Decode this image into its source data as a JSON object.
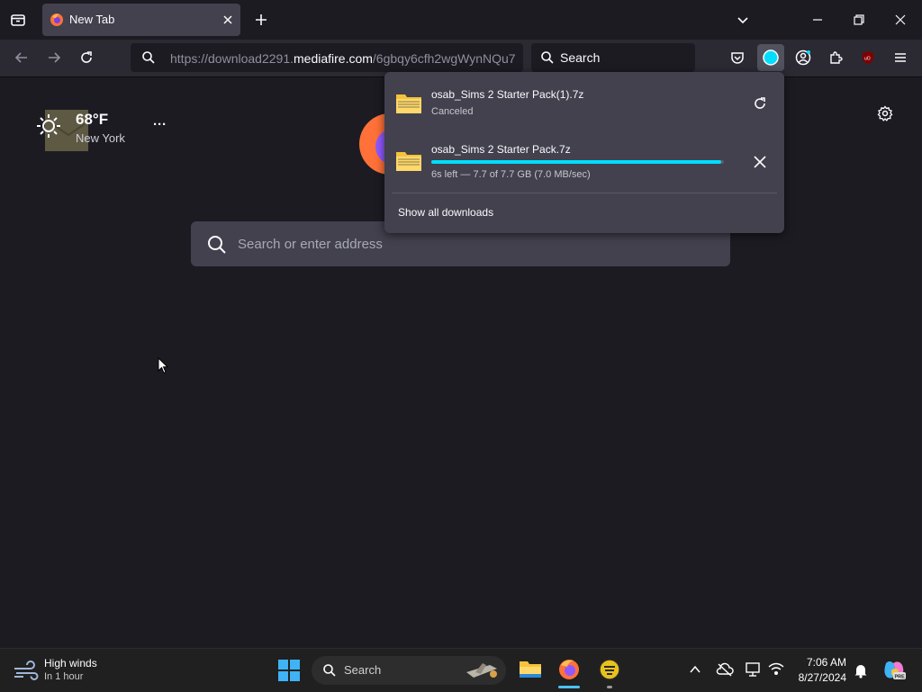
{
  "tab": {
    "title": "New Tab"
  },
  "navbar": {
    "url_prefix": "https://download2291.",
    "url_domain": "mediafire.com",
    "url_suffix": "/6gbqy6cfh2wgWynNQu7",
    "search_placeholder": "Search"
  },
  "weather_widget": {
    "temperature": "68°F",
    "city": "New York",
    "more_label": "···"
  },
  "newtab_search": {
    "placeholder": "Search or enter address"
  },
  "downloads": {
    "items": [
      {
        "filename": "osab_Sims 2 Starter Pack(1).7z",
        "status": "Canceled",
        "action": "retry"
      },
      {
        "filename": "osab_Sims 2 Starter Pack.7z",
        "status": "6s left — 7.7 of 7.7 GB (7.0 MB/sec)",
        "progress": 0.99,
        "action": "cancel"
      }
    ],
    "show_all_label": "Show all downloads"
  },
  "taskbar": {
    "weather_title": "High winds",
    "weather_subtitle": "In 1 hour",
    "search_label": "Search",
    "time": "7:06 AM",
    "date": "8/27/2024"
  },
  "colors": {
    "accent": "#00ddff",
    "folder": "#f5c23b",
    "firefox_orange": "#ff7139"
  }
}
